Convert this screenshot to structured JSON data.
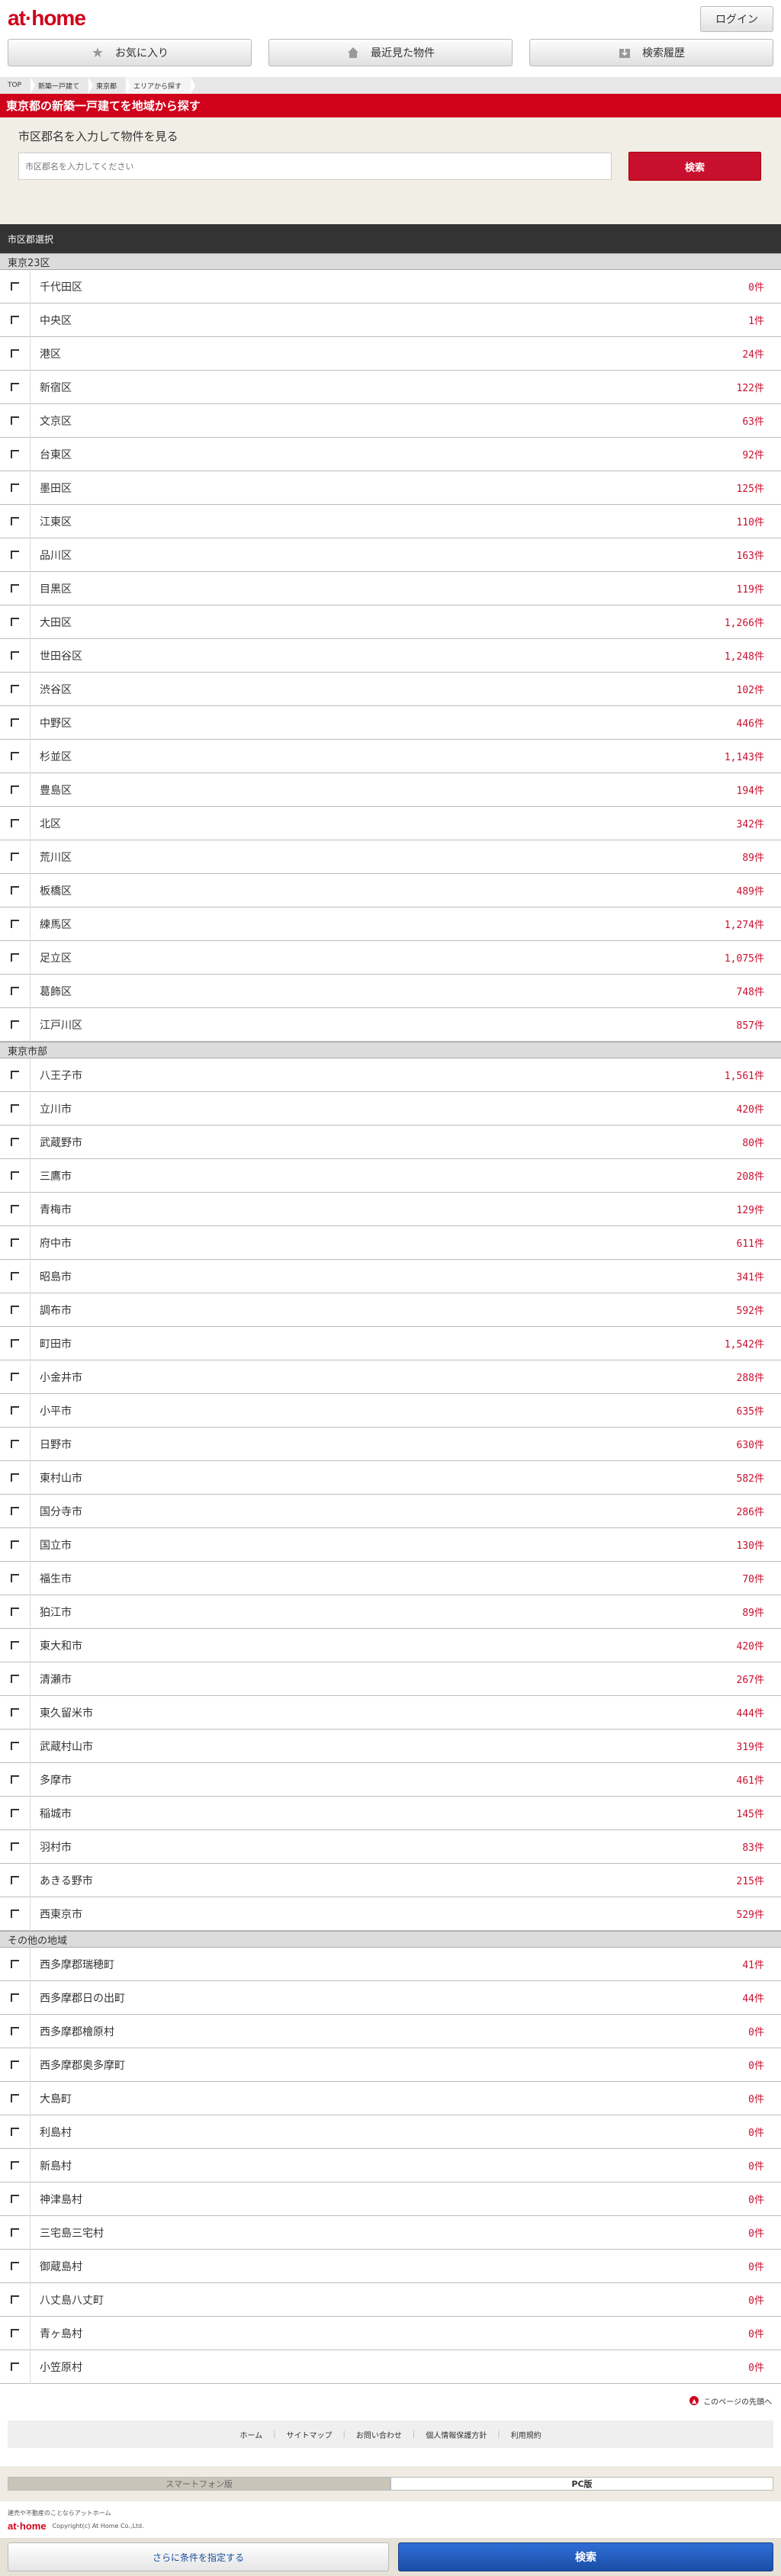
{
  "header": {
    "logo": "at·home",
    "login_label": "ログイン"
  },
  "top_nav": [
    {
      "label": "お気に入り",
      "icon": "star-icon"
    },
    {
      "label": "最近見た物件",
      "icon": "house-icon"
    },
    {
      "label": "検索履歴",
      "icon": "history-icon"
    }
  ],
  "breadcrumb": [
    "TOP",
    "新築一戸建て",
    "東京都",
    "エリアから探す"
  ],
  "page_title": "東京都の新築一戸建てを地域から探す",
  "search": {
    "label": "市区郡名を入力して物件を見る",
    "placeholder": "市区郡名を入力してください",
    "button": "検索"
  },
  "section_title": "市区郡選択",
  "groups": [
    {
      "name": "東京23区",
      "items": [
        {
          "name": "千代田区",
          "count": "0件"
        },
        {
          "name": "中央区",
          "count": "1件"
        },
        {
          "name": "港区",
          "count": "24件"
        },
        {
          "name": "新宿区",
          "count": "122件"
        },
        {
          "name": "文京区",
          "count": "63件"
        },
        {
          "name": "台東区",
          "count": "92件"
        },
        {
          "name": "墨田区",
          "count": "125件"
        },
        {
          "name": "江東区",
          "count": "110件"
        },
        {
          "name": "品川区",
          "count": "163件"
        },
        {
          "name": "目黒区",
          "count": "119件"
        },
        {
          "name": "大田区",
          "count": "1,266件"
        },
        {
          "name": "世田谷区",
          "count": "1,248件"
        },
        {
          "name": "渋谷区",
          "count": "102件"
        },
        {
          "name": "中野区",
          "count": "446件"
        },
        {
          "name": "杉並区",
          "count": "1,143件"
        },
        {
          "name": "豊島区",
          "count": "194件"
        },
        {
          "name": "北区",
          "count": "342件"
        },
        {
          "name": "荒川区",
          "count": "89件"
        },
        {
          "name": "板橋区",
          "count": "489件"
        },
        {
          "name": "練馬区",
          "count": "1,274件"
        },
        {
          "name": "足立区",
          "count": "1,075件"
        },
        {
          "name": "葛飾区",
          "count": "748件"
        },
        {
          "name": "江戸川区",
          "count": "857件"
        }
      ]
    },
    {
      "name": "東京市部",
      "items": [
        {
          "name": "八王子市",
          "count": "1,561件"
        },
        {
          "name": "立川市",
          "count": "420件"
        },
        {
          "name": "武蔵野市",
          "count": "80件"
        },
        {
          "name": "三鷹市",
          "count": "208件"
        },
        {
          "name": "青梅市",
          "count": "129件"
        },
        {
          "name": "府中市",
          "count": "611件"
        },
        {
          "name": "昭島市",
          "count": "341件"
        },
        {
          "name": "調布市",
          "count": "592件"
        },
        {
          "name": "町田市",
          "count": "1,542件"
        },
        {
          "name": "小金井市",
          "count": "288件"
        },
        {
          "name": "小平市",
          "count": "635件"
        },
        {
          "name": "日野市",
          "count": "630件"
        },
        {
          "name": "東村山市",
          "count": "582件"
        },
        {
          "name": "国分寺市",
          "count": "286件"
        },
        {
          "name": "国立市",
          "count": "130件"
        },
        {
          "name": "福生市",
          "count": "70件"
        },
        {
          "name": "狛江市",
          "count": "89件"
        },
        {
          "name": "東大和市",
          "count": "420件"
        },
        {
          "name": "清瀬市",
          "count": "267件"
        },
        {
          "name": "東久留米市",
          "count": "444件"
        },
        {
          "name": "武蔵村山市",
          "count": "319件"
        },
        {
          "name": "多摩市",
          "count": "461件"
        },
        {
          "name": "稲城市",
          "count": "145件"
        },
        {
          "name": "羽村市",
          "count": "83件"
        },
        {
          "name": "あきる野市",
          "count": "215件"
        },
        {
          "name": "西東京市",
          "count": "529件"
        }
      ]
    },
    {
      "name": "その他の地域",
      "items": [
        {
          "name": "西多摩郡瑞穂町",
          "count": "41件"
        },
        {
          "name": "西多摩郡日の出町",
          "count": "44件"
        },
        {
          "name": "西多摩郡檜原村",
          "count": "0件"
        },
        {
          "name": "西多摩郡奥多摩町",
          "count": "0件"
        },
        {
          "name": "大島町",
          "count": "0件"
        },
        {
          "name": "利島村",
          "count": "0件"
        },
        {
          "name": "新島村",
          "count": "0件"
        },
        {
          "name": "神津島村",
          "count": "0件"
        },
        {
          "name": "三宅島三宅村",
          "count": "0件"
        },
        {
          "name": "御蔵島村",
          "count": "0件"
        },
        {
          "name": "八丈島八丈町",
          "count": "0件"
        },
        {
          "name": "青ヶ島村",
          "count": "0件"
        },
        {
          "name": "小笠原村",
          "count": "0件"
        }
      ]
    }
  ],
  "pagetop": "このページの先頭へ",
  "footer_links": [
    "ホーム",
    "サイトマップ",
    "お問い合わせ",
    "個人情報保護方針",
    "利用規約"
  ],
  "device_switch": {
    "smartphone": "スマートフォン版",
    "pc": "PC版"
  },
  "footer": {
    "tagline": "建売や不動産のことならアットホーム",
    "small_logo": "at·home",
    "copyright": "Copyright(c) At Home Co.,Ltd."
  },
  "bottom_bar": {
    "more_conditions": "さらに条件を指定する",
    "search": "検索"
  },
  "colors": {
    "brand_red": "#d0021b",
    "count_red": "#c8102e",
    "search_blue": "#1b4ea6"
  }
}
